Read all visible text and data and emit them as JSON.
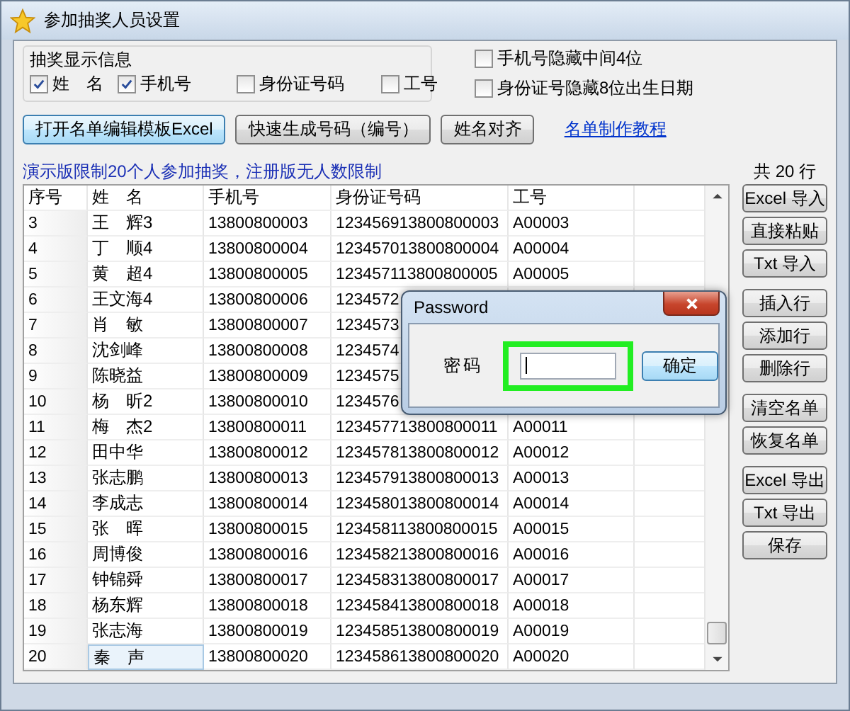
{
  "window": {
    "title": "参加抽奖人员设置"
  },
  "display_group": {
    "title": "抽奖显示信息",
    "options": [
      {
        "label": "姓　名",
        "checked": true
      },
      {
        "label": "手机号",
        "checked": true
      },
      {
        "label": "身份证号码",
        "checked": false
      },
      {
        "label": "工号",
        "checked": false
      }
    ]
  },
  "hide_options": [
    {
      "label": "手机号隐藏中间4位",
      "checked": false
    },
    {
      "label": "身份证号隐藏8位出生日期",
      "checked": false
    }
  ],
  "toolbar": [
    {
      "label": "打开名单编辑模板Excel",
      "selected": true
    },
    {
      "label": "快速生成号码（编号）",
      "selected": false
    },
    {
      "label": "姓名对齐",
      "selected": false
    }
  ],
  "tutorial_link": "名单制作教程",
  "notice": "演示版限制20个人参加抽奖，注册版无人数限制",
  "row_count": "共 20 行",
  "table": {
    "columns": [
      "序号",
      "姓　名",
      "手机号",
      "身份证号码",
      "工号"
    ],
    "rows": [
      {
        "no": "3",
        "name": "王　辉3",
        "phone": "13800800003",
        "id": "123456913800800003",
        "emp_no": "A00003",
        "selected": false
      },
      {
        "no": "4",
        "name": "丁　顺4",
        "phone": "13800800004",
        "id": "123457013800800004",
        "emp_no": "A00004",
        "selected": false
      },
      {
        "no": "5",
        "name": "黄　超4",
        "phone": "13800800005",
        "id": "123457113800800005",
        "emp_no": "A00005",
        "selected": false
      },
      {
        "no": "6",
        "name": "王文海4",
        "phone": "13800800006",
        "id": "1234572",
        "selected": false
      },
      {
        "no": "7",
        "name": "肖　敏",
        "phone": "13800800007",
        "id": "1234573",
        "selected": false
      },
      {
        "no": "8",
        "name": "沈剑峰",
        "phone": "13800800008",
        "id": "1234574",
        "selected": false
      },
      {
        "no": "9",
        "name": "陈晓益",
        "phone": "13800800009",
        "id": "1234575",
        "selected": false
      },
      {
        "no": "10",
        "name": "杨　昕2",
        "phone": "13800800010",
        "id": "1234576",
        "selected": false
      },
      {
        "no": "11",
        "name": "梅　杰2",
        "phone": "13800800011",
        "id": "123457713800800011",
        "emp_no": "A00011",
        "selected": false
      },
      {
        "no": "12",
        "name": "田中华",
        "phone": "13800800012",
        "id": "123457813800800012",
        "emp_no": "A00012",
        "selected": false
      },
      {
        "no": "13",
        "name": "张志鹏",
        "phone": "13800800013",
        "id": "123457913800800013",
        "emp_no": "A00013",
        "selected": false
      },
      {
        "no": "14",
        "name": "李成志",
        "phone": "13800800014",
        "id": "123458013800800014",
        "emp_no": "A00014",
        "selected": false
      },
      {
        "no": "15",
        "name": "张　晖",
        "phone": "13800800015",
        "id": "123458113800800015",
        "emp_no": "A00015",
        "selected": false
      },
      {
        "no": "16",
        "name": "周博俊",
        "phone": "13800800016",
        "id": "123458213800800016",
        "emp_no": "A00016",
        "selected": false
      },
      {
        "no": "17",
        "name": "钟锦舜",
        "phone": "13800800017",
        "id": "123458313800800017",
        "emp_no": "A00017",
        "selected": false
      },
      {
        "no": "18",
        "name": "杨东辉",
        "phone": "13800800018",
        "id": "123458413800800018",
        "emp_no": "A00018",
        "selected": false
      },
      {
        "no": "19",
        "name": "张志海",
        "phone": "13800800019",
        "id": "123458513800800019",
        "emp_no": "A00019",
        "selected": false
      },
      {
        "no": "20",
        "name": "秦　声",
        "phone": "13800800020",
        "id": "123458613800800020",
        "emp_no": "A00020",
        "selected": true
      }
    ]
  },
  "side_buttons": [
    [
      "Excel 导入",
      "直接粘贴",
      "Txt 导入"
    ],
    [
      "插入行",
      "添加行",
      "删除行"
    ],
    [
      "清空名单",
      "恢复名单"
    ],
    [
      "Excel 导出",
      "Txt 导出",
      "保存"
    ]
  ],
  "dialog": {
    "title": "Password",
    "label": "密码",
    "confirm": "确定"
  }
}
